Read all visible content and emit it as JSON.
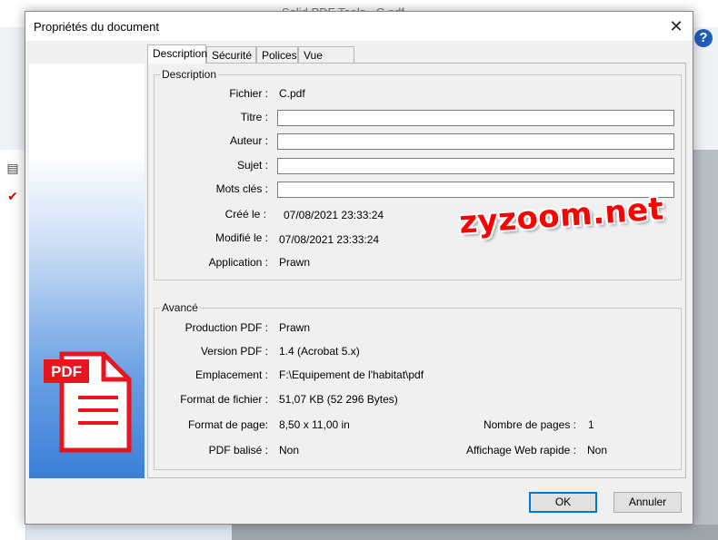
{
  "background_app": {
    "title": "Solid PDF Tools - C.pdf",
    "help_label": "?"
  },
  "dialog": {
    "title": "Propriétés du document",
    "close_label": "✕",
    "tabs": [
      {
        "label": "Description",
        "active": true
      },
      {
        "label": "Sécurité",
        "active": false
      },
      {
        "label": "Polices",
        "active": false
      },
      {
        "label": "Vue initiale",
        "active": false
      }
    ],
    "description": {
      "legend": "Description",
      "fichier_label": "Fichier :",
      "fichier_value": "C.pdf",
      "titre_label": "Titre :",
      "titre_value": "",
      "auteur_label": "Auteur :",
      "auteur_value": "",
      "sujet_label": "Sujet :",
      "sujet_value": "",
      "motscles_label": "Mots clés :",
      "motscles_value": "",
      "cree_label": "Créé le :",
      "cree_value": "07/08/2021 23:33:24",
      "modifie_label": "Modifié le :",
      "modifie_value": "07/08/2021 23:33:24",
      "application_label": "Application :",
      "application_value": "Prawn"
    },
    "avance": {
      "legend": "Avancé",
      "production_label": "Production PDF :",
      "production_value": "Prawn",
      "version_label": "Version PDF :",
      "version_value": "1.4 (Acrobat 5.x)",
      "emplacement_label": "Emplacement :",
      "emplacement_value": "F:\\Equipement de l'habitat\\pdf",
      "format_fichier_label": "Format de fichier :",
      "format_fichier_value": "51,07 KB (52 296 Bytes)",
      "format_page_label": "Format de page:",
      "format_page_value": "8,50 x 11,00 in",
      "nb_pages_label": "Nombre de pages :",
      "nb_pages_value": "1",
      "balise_label": "PDF balisé :",
      "balise_value": "Non",
      "web_label": "Affichage Web rapide :",
      "web_value": "Non"
    },
    "watermark": "zyzoom.net",
    "pdf_icon_label": "PDF",
    "ok_label": "OK",
    "cancel_label": "Annuler"
  },
  "colors": {
    "accent": "#0078d7",
    "pdf_red": "#e8141e",
    "watermark": "#ff0000"
  }
}
